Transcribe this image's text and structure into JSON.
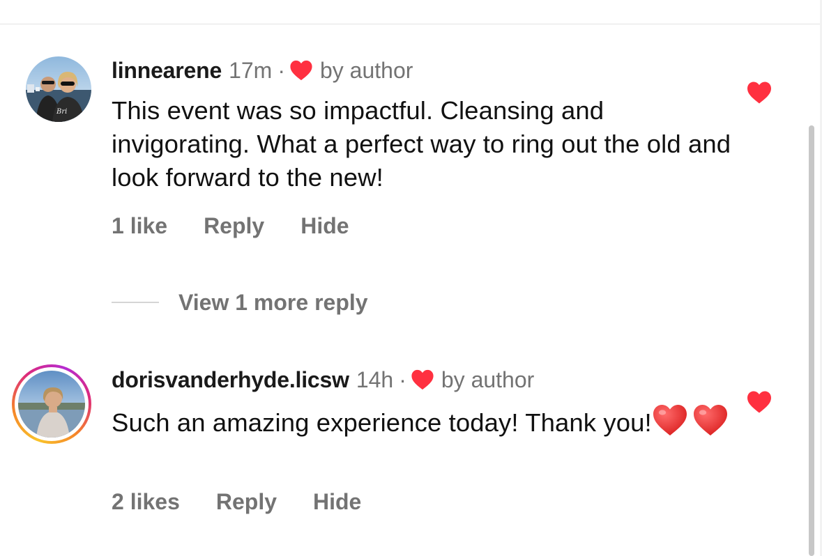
{
  "comments": [
    {
      "username": "linnearene",
      "time": "17m",
      "separator": "·",
      "liked_by": "by author",
      "text": "This event was so impactful. Cleansing and invigorating. What a perfect way to ring out the old and look forward to the new!",
      "likes": "1 like",
      "reply_label": "Reply",
      "hide_label": "Hide",
      "liked": true,
      "avatar_story_ring": false
    },
    {
      "username": "dorisvanderhyde.licsw",
      "time": "14h",
      "separator": "·",
      "liked_by": "by author",
      "text": "Such an amazing experience today! Thank you!",
      "emojis": [
        "red-heart",
        "red-heart"
      ],
      "likes": "2 likes",
      "reply_label": "Reply",
      "hide_label": "Hide",
      "liked": true,
      "avatar_story_ring": true
    }
  ],
  "view_more": {
    "label": "View 1 more reply"
  },
  "colors": {
    "heart_red": "#ff3040",
    "muted_text": "#737373",
    "body_text": "#111111"
  }
}
